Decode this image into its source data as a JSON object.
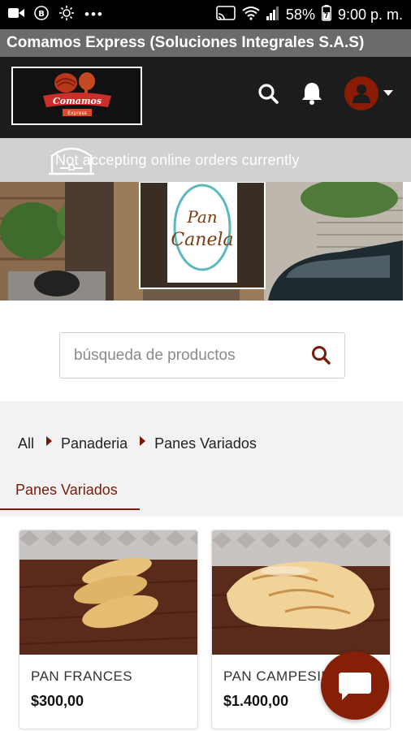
{
  "status_bar": {
    "battery": "58%",
    "time": "9:00 p. m."
  },
  "app": {
    "title": "Comamos Express (Soluciones Integrales S.A.S)"
  },
  "header": {
    "logo_alt": "Comamos Express",
    "icons": [
      "search-icon",
      "bell-icon",
      "user-icon",
      "caret-down-icon"
    ]
  },
  "notice": {
    "text": "Not accepting online orders currently"
  },
  "banner": {
    "store_name_line1": "Pan",
    "store_name_line2": "Canela"
  },
  "search": {
    "placeholder": "búsqueda de productos"
  },
  "breadcrumb": {
    "items": [
      "All",
      "Panaderia",
      "Panes Variados"
    ]
  },
  "tabs": {
    "active": "Panes Variados"
  },
  "products": [
    {
      "name": "PAN FRANCES",
      "price": "$300,00"
    },
    {
      "name": "PAN CAMPESINO",
      "price": "$1.400,00"
    }
  ],
  "colors": {
    "accent": "#852007",
    "header_bg": "#1c1c1c",
    "title_bar_bg": "#6b6b6b",
    "notice_bg": "#d1d1d1"
  }
}
